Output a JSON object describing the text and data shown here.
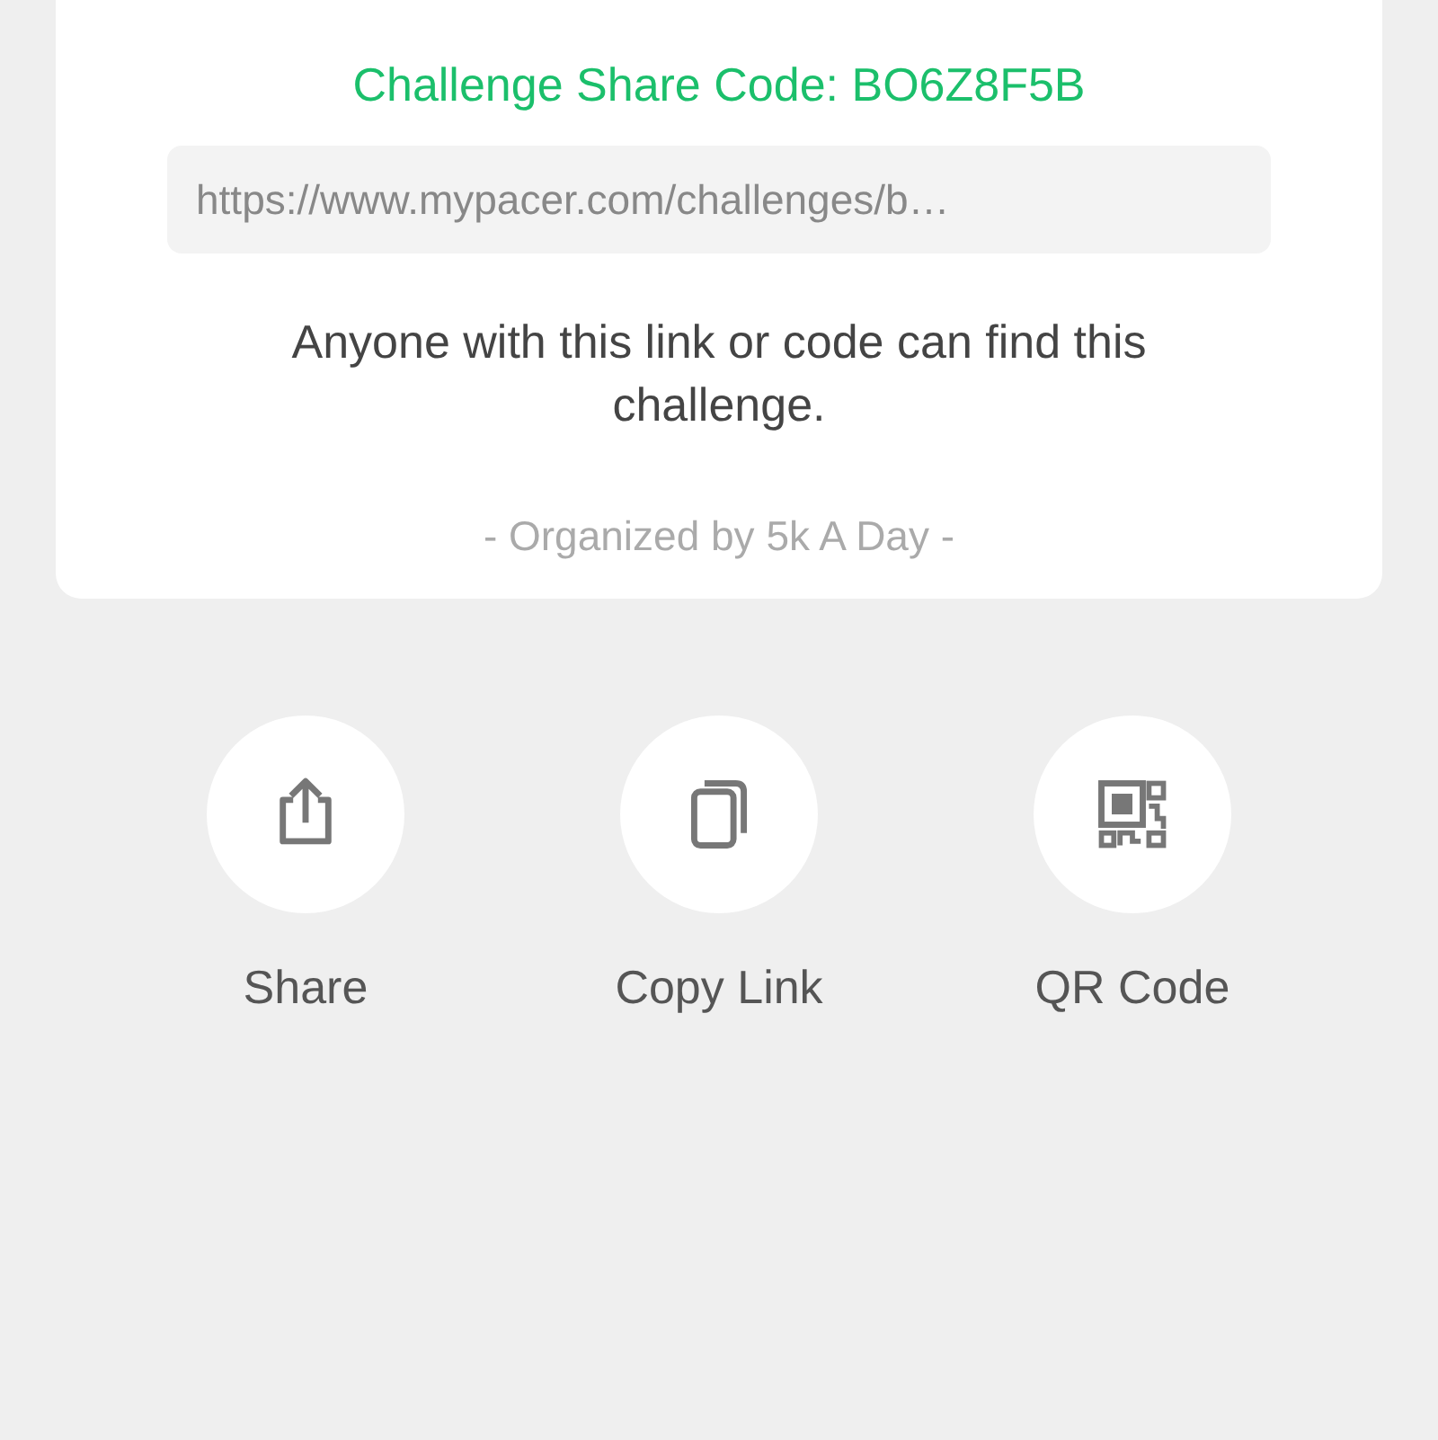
{
  "challenge": {
    "share_code": "Challenge Share Code: BO6Z8F5B",
    "link": "https://www.mypacer.com/challenges/b…",
    "description": "Anyone with this link or code can find this challenge.",
    "organizer": "- Organized by 5k A Day -"
  },
  "actions": [
    {
      "kind": "share",
      "label": "Share"
    },
    {
      "kind": "copy",
      "label": "Copy Link"
    },
    {
      "kind": "qr",
      "label": "QR Code"
    }
  ]
}
